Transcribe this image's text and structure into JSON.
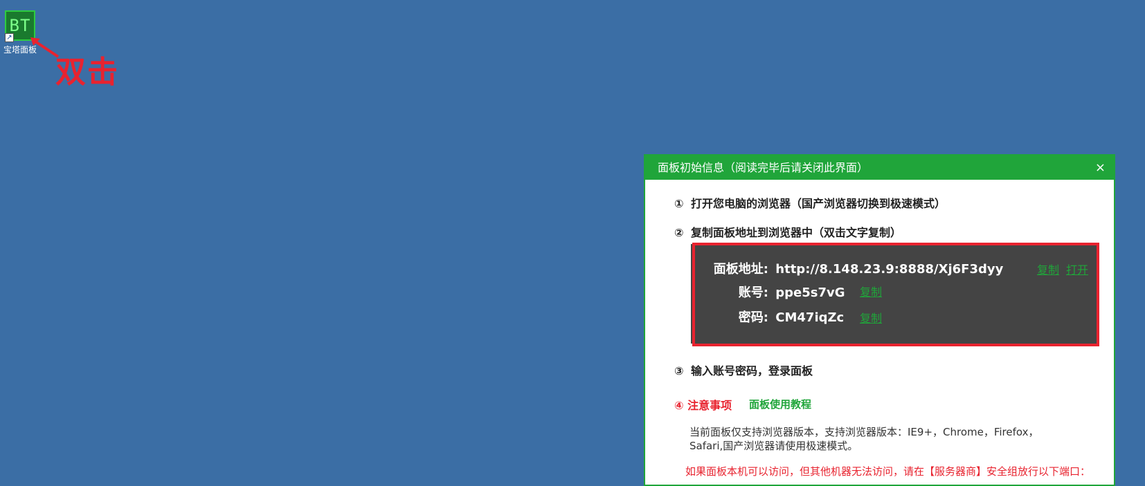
{
  "desktop": {
    "icon_text": "BT",
    "icon_label": "宝塔面板",
    "annotation": "双击"
  },
  "dialog": {
    "title": "面板初始信息（阅读完毕后请关闭此界面）",
    "close": "×",
    "step1": {
      "num": "①",
      "text": "打开您电脑的浏览器（国产浏览器切换到极速模式）"
    },
    "step2": {
      "num": "②",
      "text": "复制面板地址到浏览器中（双击文字复制）"
    },
    "address_label": "面板地址:",
    "address_value": "http://8.148.23.9:8888/Xj6F3dyy",
    "account_label": "账号:",
    "account_value": "ppe5s7vG",
    "password_label": "密码:",
    "password_value": "CM47iqZc",
    "copy_label": "复制",
    "open_label": "打开",
    "step3": {
      "num": "③",
      "text": "输入账号密码，登录面板"
    },
    "step4": {
      "num": "④",
      "text": "注意事项"
    },
    "tutorial_link": "面板使用教程",
    "note_line1": "当前面板仅支持浏览器版本，支持浏览器版本：IE9+，Chrome，Firefox，",
    "note_line2": "Safari,国产浏览器请使用极速模式。",
    "warning": "如果面板本机可以访问，但其他机器无法访问，请在【服务器商】安全组放行以下端口："
  },
  "colors": {
    "desktop_bg": "#3b6ea5",
    "accent": "#20a53a",
    "alert": "#e8232f"
  }
}
